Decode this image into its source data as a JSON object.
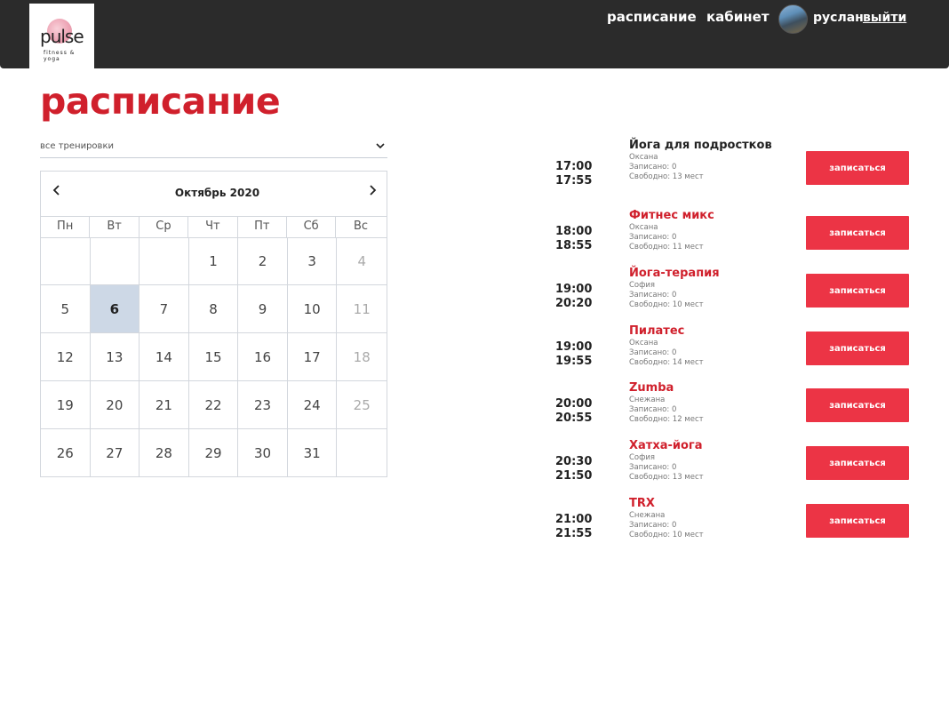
{
  "header": {
    "logo": {
      "text": "pulse",
      "subtext": "fitness & yoga"
    },
    "nav": {
      "schedule": "расписание",
      "cabinet": "кабинет"
    },
    "user": {
      "name": "руслан",
      "logout": "выйти"
    }
  },
  "page": {
    "title": "расписание"
  },
  "filter": {
    "selected": "все тренировки"
  },
  "calendar": {
    "month_label": "Октябрь 2020",
    "weekdays": [
      "Пн",
      "Вт",
      "Ср",
      "Чт",
      "Пт",
      "Сб",
      "Вс"
    ],
    "selected_day": "6",
    "weeks": [
      [
        "",
        "",
        "",
        "1",
        "2",
        "3",
        "4"
      ],
      [
        "5",
        "6",
        "7",
        "8",
        "9",
        "10",
        "11"
      ],
      [
        "12",
        "13",
        "14",
        "15",
        "16",
        "17",
        "18"
      ],
      [
        "19",
        "20",
        "21",
        "22",
        "23",
        "24",
        "25"
      ],
      [
        "26",
        "27",
        "28",
        "29",
        "30",
        "31",
        ""
      ]
    ]
  },
  "classes": [
    {
      "start": "17:00",
      "end": "17:55",
      "name": "Йога для подростков",
      "trainer": "Оксана",
      "booked": "Записано: 0",
      "free": "Свободно: 13 мест",
      "button": "записаться"
    },
    {
      "start": "18:00",
      "end": "18:55",
      "name": "Фитнес микс",
      "trainer": "Оксана",
      "booked": "Записано: 0",
      "free": "Свободно: 11 мест",
      "button": "записаться"
    },
    {
      "start": "19:00",
      "end": "20:20",
      "name": "Йога-терапия",
      "trainer": "София",
      "booked": "Записано: 0",
      "free": "Свободно: 10 мест",
      "button": "записаться"
    },
    {
      "start": "19:00",
      "end": "19:55",
      "name": "Пилатес",
      "trainer": "Оксана",
      "booked": "Записано: 0",
      "free": "Свободно: 14 мест",
      "button": "записаться"
    },
    {
      "start": "20:00",
      "end": "20:55",
      "name": "Zumba",
      "trainer": "Снежана",
      "booked": "Записано: 0",
      "free": "Свободно: 12 мест",
      "button": "записаться"
    },
    {
      "start": "20:30",
      "end": "21:50",
      "name": "Хатха-йога",
      "trainer": "София",
      "booked": "Записано: 0",
      "free": "Свободно: 13 мест",
      "button": "записаться"
    },
    {
      "start": "21:00",
      "end": "21:55",
      "name": "TRX",
      "trainer": "Снежана",
      "booked": "Записано: 0",
      "free": "Свободно: 10 мест",
      "button": "записаться"
    }
  ],
  "colors": {
    "accent": "#d0202c",
    "button": "#ec3445",
    "header_bg": "#2b2b2b",
    "selected_day_bg": "#cdd8e6"
  },
  "icons": {
    "prev": "chevron-left-icon",
    "next": "chevron-right-icon",
    "dropdown": "chevron-down-icon"
  }
}
